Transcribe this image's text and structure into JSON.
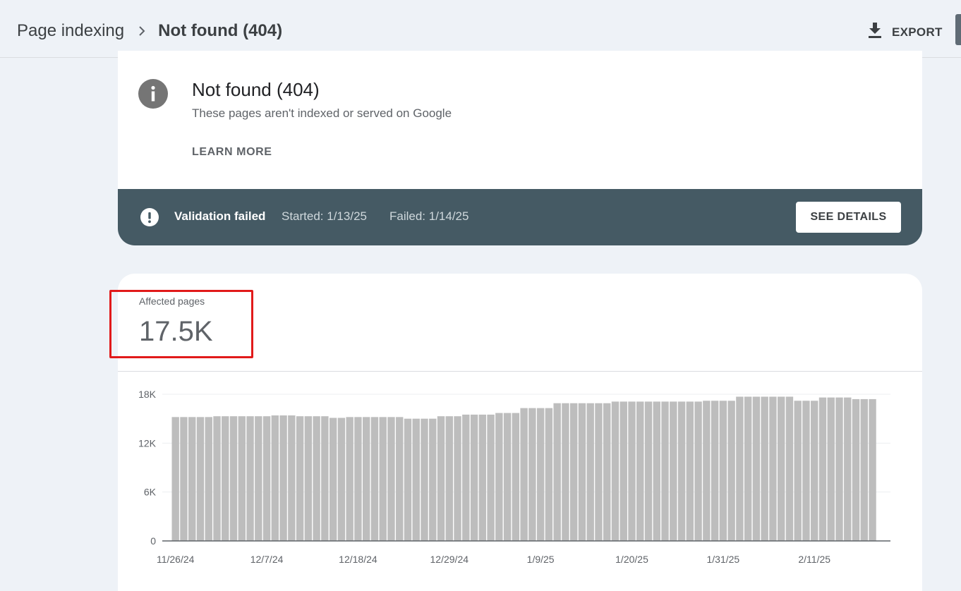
{
  "header": {
    "breadcrumb_parent": "Page indexing",
    "breadcrumb_current": "Not found (404)",
    "export_label": "EXPORT",
    "separator_icon": "chevron-right-icon",
    "export_icon": "download-icon"
  },
  "info_card": {
    "icon": "info-icon",
    "title": "Not found (404)",
    "description": "These pages aren't indexed or served on Google",
    "learn_more": "LEARN MORE"
  },
  "validation": {
    "icon": "alert-icon",
    "status": "Validation failed",
    "started": "Started: 1/13/25",
    "failed": "Failed: 1/14/25",
    "button": "SEE DETAILS"
  },
  "metric": {
    "label": "Affected pages",
    "value": "17.5K"
  },
  "colors": {
    "bar": "#bdbdbd",
    "validation_bg": "#455a64",
    "highlight": "#e11a1a",
    "page_bg": "#eef2f7"
  },
  "chart_data": {
    "type": "bar",
    "series": [
      {
        "values": [
          15200,
          15200,
          15200,
          15200,
          15200,
          15300,
          15300,
          15300,
          15300,
          15300,
          15300,
          15300,
          15400,
          15400,
          15400,
          15300,
          15300,
          15300,
          15300,
          15100,
          15100,
          15200,
          15200,
          15200,
          15200,
          15200,
          15200,
          15200,
          15000,
          15000,
          15000,
          15000,
          15300,
          15300,
          15300,
          15500,
          15500,
          15500,
          15500,
          15700,
          15700,
          15700,
          16300,
          16300,
          16300,
          16300,
          16900,
          16900,
          16900,
          16900,
          16900,
          16900,
          16900,
          17100,
          17100,
          17100,
          17100,
          17100,
          17100,
          17100,
          17100,
          17100,
          17100,
          17100,
          17200,
          17200,
          17200,
          17200,
          17700,
          17700,
          17700,
          17700,
          17700,
          17700,
          17700,
          17200,
          17200,
          17200,
          17600,
          17600,
          17600,
          17600,
          17400,
          17400,
          17400
        ]
      }
    ],
    "x_tick_labels": [
      "11/26/24",
      "12/7/24",
      "12/18/24",
      "12/29/24",
      "1/9/25",
      "1/20/25",
      "1/31/25",
      "2/11/25"
    ],
    "x_tick_indices": [
      0,
      11,
      22,
      33,
      44,
      55,
      66,
      77
    ],
    "y_tick_labels": [
      "0",
      "6K",
      "12K",
      "18K"
    ],
    "y_ticks": [
      0,
      6000,
      12000,
      18000
    ],
    "ylim": [
      0,
      18000
    ],
    "grid": true,
    "xlabel": "",
    "ylabel": ""
  }
}
